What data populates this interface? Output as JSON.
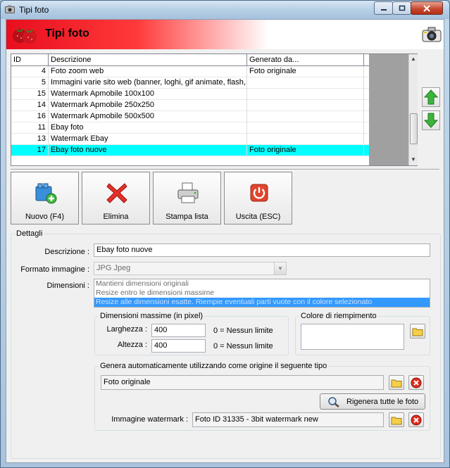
{
  "window": {
    "title": "Tipi foto",
    "banner_title": "Tipi foto"
  },
  "list": {
    "columns": [
      "ID",
      "Descrizione",
      "Generato da..."
    ],
    "rows": [
      {
        "id": "4",
        "desc": "Foto zoom web",
        "gen": "Foto originale"
      },
      {
        "id": "5",
        "desc": "Immagini varie sito web (banner, loghi, gif animate, flash, ...",
        "gen": ""
      },
      {
        "id": "15",
        "desc": "Watermark Apmobile 100x100",
        "gen": ""
      },
      {
        "id": "14",
        "desc": "Watermark Apmobile 250x250",
        "gen": ""
      },
      {
        "id": "16",
        "desc": "Watermark Apmobile 500x500",
        "gen": ""
      },
      {
        "id": "11",
        "desc": "Ebay foto",
        "gen": ""
      },
      {
        "id": "13",
        "desc": "Watermark Ebay",
        "gen": ""
      },
      {
        "id": "17",
        "desc": "Ebay foto nuove",
        "gen": "Foto originale"
      }
    ],
    "selected_index": 7
  },
  "toolbar": {
    "new_label": "Nuovo (F4)",
    "delete_label": "Elimina",
    "print_label": "Stampa lista",
    "exit_label": "Uscita (ESC)"
  },
  "details": {
    "group_title": "Dettagli",
    "descrizione_label": "Descrizione :",
    "descrizione_value": "Ebay foto nuove",
    "formato_label": "Formato immagine :",
    "formato_value": "JPG Jpeg",
    "dimensioni_label": "Dimensioni :",
    "dimensioni_options": [
      "Mantieni dimensioni originali",
      "Resize entro le dimensioni massime",
      "Resize alle dimensioni esatte. Riempie eventuali parti vuote con il colore selezionato"
    ],
    "dimensioni_selected": 2,
    "maxdim": {
      "title": "Dimensioni massime (in pixel)",
      "larghezza_label": "Larghezza :",
      "larghezza_value": "400",
      "larghezza_hint": "0 = Nessun limite",
      "altezza_label": "Altezza :",
      "altezza_value": "400",
      "altezza_hint": "0 = Nessun limite"
    },
    "fill_color": {
      "title": "Colore di riempimento",
      "value": ""
    },
    "generate": {
      "title": "Genera automaticamente utilizzando come origine il seguente tipo",
      "source_value": "Foto originale",
      "regen_label": "Rigenera tutte le foto",
      "watermark_label": "Immagine watermark :",
      "watermark_value": "Foto ID 31335 - 3bit watermark new"
    }
  },
  "colors": {
    "selection": "#00ffff",
    "listbox_selection": "#3399ff",
    "banner_red": "#e80e1e"
  }
}
